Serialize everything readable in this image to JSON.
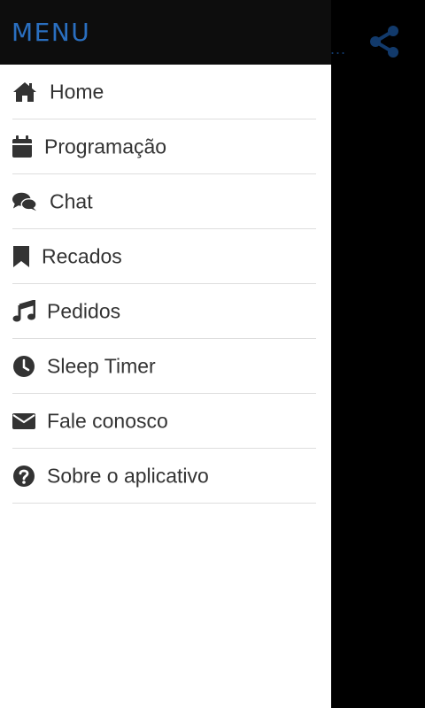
{
  "app": {
    "menu_title": "MENU",
    "background_overflow_text": "..."
  },
  "colors": {
    "drawer_header_bg": "#0d0d0d",
    "menu_title": "#2a6fc0",
    "icon": "#333333",
    "background_accent": "#123a6b"
  },
  "menu": {
    "items": [
      {
        "label": "Home",
        "icon": "home-icon"
      },
      {
        "label": "Programação",
        "icon": "calendar-icon"
      },
      {
        "label": "Chat",
        "icon": "chat-icon"
      },
      {
        "label": "Recados",
        "icon": "bookmark-icon"
      },
      {
        "label": "Pedidos",
        "icon": "music-icon"
      },
      {
        "label": "Sleep Timer",
        "icon": "clock-icon"
      },
      {
        "label": "Fale conosco",
        "icon": "envelope-icon"
      },
      {
        "label": "Sobre o aplicativo",
        "icon": "question-circle-icon"
      }
    ]
  }
}
